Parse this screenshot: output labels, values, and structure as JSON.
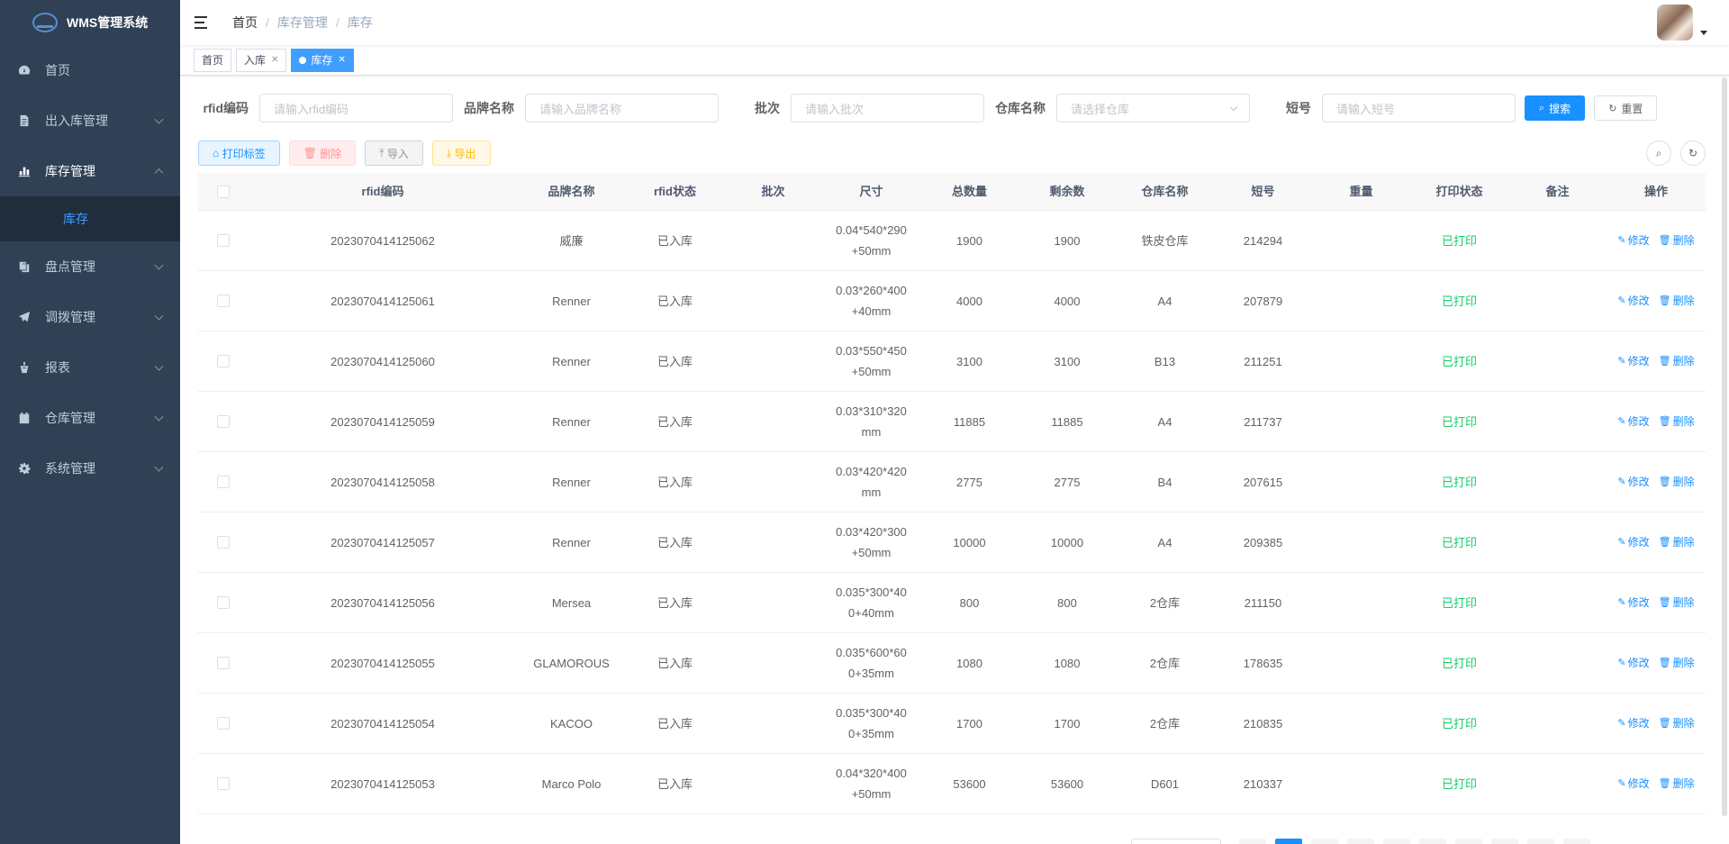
{
  "app": {
    "title": "WMS管理系统"
  },
  "sidebar": {
    "items": [
      {
        "label": "首页",
        "icon": "dashboard-icon"
      },
      {
        "label": "出入库管理",
        "icon": "document-icon"
      },
      {
        "label": "库存管理",
        "icon": "bar-chart-icon",
        "expanded": true,
        "children": [
          {
            "label": "库存",
            "active": true
          }
        ]
      },
      {
        "label": "盘点管理",
        "icon": "clipboard-icon"
      },
      {
        "label": "调拨管理",
        "icon": "paper-plane-icon"
      },
      {
        "label": "报表",
        "icon": "report-icon"
      },
      {
        "label": "仓库管理",
        "icon": "calendar-icon"
      },
      {
        "label": "系统管理",
        "icon": "gear-icon"
      }
    ]
  },
  "breadcrumb": [
    "首页",
    "库存管理",
    "库存"
  ],
  "tags": [
    {
      "label": "首页"
    },
    {
      "label": "入库"
    },
    {
      "label": "库存",
      "active": true
    }
  ],
  "filters": {
    "rfid": {
      "label": "rfid编码",
      "placeholder": "请输入rfid编码"
    },
    "brand": {
      "label": "品牌名称",
      "placeholder": "请输入品牌名称"
    },
    "batch": {
      "label": "批次",
      "placeholder": "请输入批次"
    },
    "warehouse": {
      "label": "仓库名称",
      "placeholder": "请选择仓库"
    },
    "short": {
      "label": "短号",
      "placeholder": "请输入短号"
    },
    "search_label": "搜索",
    "reset_label": "重置"
  },
  "toolbar": {
    "print": "打印标签",
    "delete": "删除",
    "import": "导入",
    "export": "导出"
  },
  "table": {
    "headers": [
      "rfid编码",
      "品牌名称",
      "rfid状态",
      "批次",
      "尺寸",
      "总数量",
      "剩余数",
      "仓库名称",
      "短号",
      "重量",
      "打印状态",
      "备注",
      "操作"
    ],
    "edit_label": "修改",
    "delete_label": "删除",
    "rows": [
      {
        "rfid": "2023070414125062",
        "brand": "威廉",
        "status": "已入库",
        "batch": "",
        "size1": "0.04*540*290",
        "size2": "+50mm",
        "total": "1900",
        "remaining": "1900",
        "warehouse": "铁皮仓库",
        "short": "214294",
        "weight": "",
        "print": "已打印",
        "note": ""
      },
      {
        "rfid": "2023070414125061",
        "brand": "Renner",
        "status": "已入库",
        "batch": "",
        "size1": "0.03*260*400",
        "size2": "+40mm",
        "total": "4000",
        "remaining": "4000",
        "warehouse": "A4",
        "short": "207879",
        "weight": "",
        "print": "已打印",
        "note": ""
      },
      {
        "rfid": "2023070414125060",
        "brand": "Renner",
        "status": "已入库",
        "batch": "",
        "size1": "0.03*550*450",
        "size2": "+50mm",
        "total": "3100",
        "remaining": "3100",
        "warehouse": "B13",
        "short": "211251",
        "weight": "",
        "print": "已打印",
        "note": ""
      },
      {
        "rfid": "2023070414125059",
        "brand": "Renner",
        "status": "已入库",
        "batch": "",
        "size1": "0.03*310*320",
        "size2": "mm",
        "total": "11885",
        "remaining": "11885",
        "warehouse": "A4",
        "short": "211737",
        "weight": "",
        "print": "已打印",
        "note": ""
      },
      {
        "rfid": "2023070414125058",
        "brand": "Renner",
        "status": "已入库",
        "batch": "",
        "size1": "0.03*420*420",
        "size2": "mm",
        "total": "2775",
        "remaining": "2775",
        "warehouse": "B4",
        "short": "207615",
        "weight": "",
        "print": "已打印",
        "note": ""
      },
      {
        "rfid": "2023070414125057",
        "brand": "Renner",
        "status": "已入库",
        "batch": "",
        "size1": "0.03*420*300",
        "size2": "+50mm",
        "total": "10000",
        "remaining": "10000",
        "warehouse": "A4",
        "short": "209385",
        "weight": "",
        "print": "已打印",
        "note": ""
      },
      {
        "rfid": "2023070414125056",
        "brand": "Mersea",
        "status": "已入库",
        "batch": "",
        "size1": "0.035*300*40",
        "size2": "0+40mm",
        "total": "800",
        "remaining": "800",
        "warehouse": "2仓库",
        "short": "211150",
        "weight": "",
        "print": "已打印",
        "note": ""
      },
      {
        "rfid": "2023070414125055",
        "brand": "GLAMOROUS",
        "status": "已入库",
        "batch": "",
        "size1": "0.035*600*60",
        "size2": "0+35mm",
        "total": "1080",
        "remaining": "1080",
        "warehouse": "2仓库",
        "short": "178635",
        "weight": "",
        "print": "已打印",
        "note": ""
      },
      {
        "rfid": "2023070414125054",
        "brand": "KACOO",
        "status": "已入库",
        "batch": "",
        "size1": "0.035*300*40",
        "size2": "0+35mm",
        "total": "1700",
        "remaining": "1700",
        "warehouse": "2仓库",
        "short": "210835",
        "weight": "",
        "print": "已打印",
        "note": ""
      },
      {
        "rfid": "2023070414125053",
        "brand": "Marco Polo",
        "status": "已入库",
        "batch": "",
        "size1": "0.04*320*400",
        "size2": "+50mm",
        "total": "53600",
        "remaining": "53600",
        "warehouse": "D601",
        "short": "210337",
        "weight": "",
        "print": "已打印",
        "note": ""
      }
    ]
  },
  "pagination": {
    "active_page": 1
  },
  "colors": {
    "sidebar_bg": "#304156",
    "accent": "#1890ff",
    "printed": "#13ce66"
  }
}
